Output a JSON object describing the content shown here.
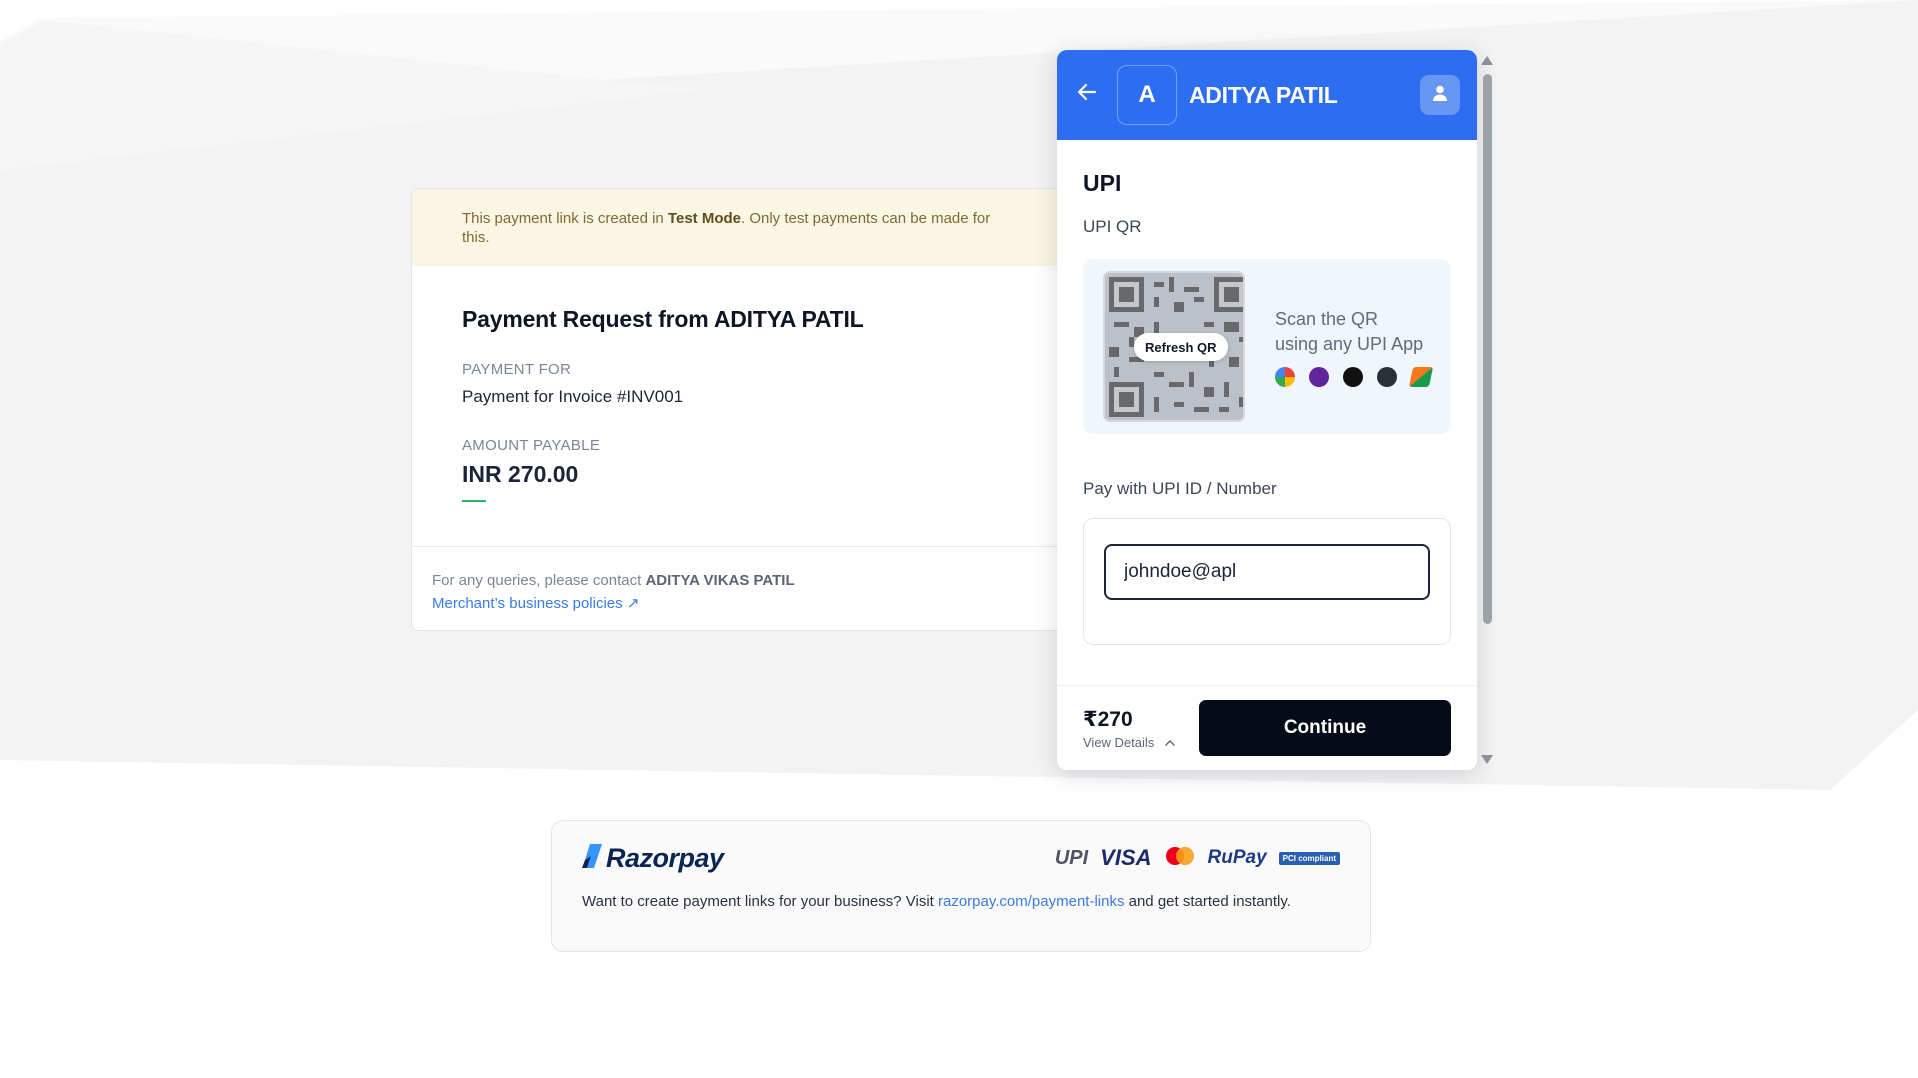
{
  "test_banner": {
    "prefix": "This payment link is created in ",
    "mode": "Test Mode",
    "suffix": ". Only test payments can be made for this."
  },
  "request": {
    "title": "Payment Request from ADITYA PATIL",
    "payment_for_label": "PAYMENT FOR",
    "payment_for_value": "Payment for Invoice #INV001",
    "amount_label": "AMOUNT PAYABLE",
    "amount_value": "INR 270.00"
  },
  "contact": {
    "prefix": "For any queries, please contact ",
    "name": "ADITYA VIKAS PATIL",
    "policy_link": "Merchant’s business policies ↗"
  },
  "checkout": {
    "avatar_letter": "A",
    "merchant_name": "ADITYA PATIL",
    "section_title": "UPI",
    "qr_label": "UPI QR",
    "refresh_qr": "Refresh QR",
    "scan_line1": "Scan the QR",
    "scan_line2": "using any UPI App",
    "upi_id_label": "Pay with UPI ID / Number",
    "upi_id_value": "johndoe@apl",
    "footer_amount": "₹270",
    "view_details": "View Details",
    "continue_label": "Continue"
  },
  "icons": {
    "back": "back-arrow-icon",
    "profile": "user-icon",
    "details_toggle": "chevron-up-icon",
    "apps": [
      "google-pay-icon",
      "phonepe-icon",
      "cred-icon",
      "paytm-icon",
      "bhim-icon"
    ]
  },
  "colors": {
    "header_blue": "#2d6ef0",
    "continue_black": "#050b17",
    "test_banner_bg": "#fbf6e3",
    "amount_underline": "#2bb36d",
    "link_blue": "#3a7be6"
  },
  "razorpay": {
    "brand": "Razorpay",
    "payment_logos": [
      "UPI",
      "VISA",
      "RuPay",
      "PCI compliant"
    ],
    "text_prefix": "Want to create payment links for your business? Visit ",
    "link": "razorpay.com/payment-links",
    "text_suffix": " and get started instantly."
  }
}
